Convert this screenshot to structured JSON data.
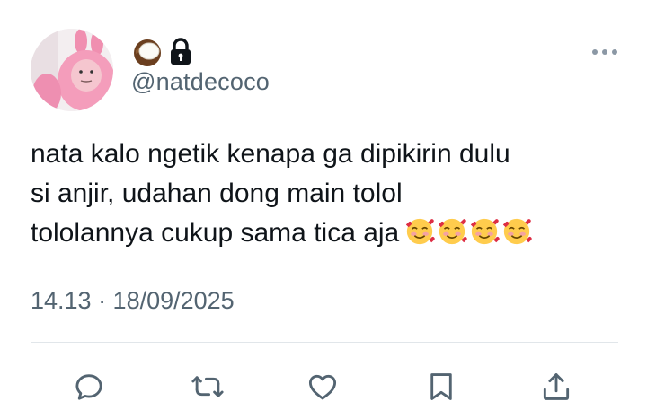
{
  "tweet": {
    "display_name_emoji": "coconut-emoji",
    "protected_icon": "lock-icon",
    "handle": "@natdecoco",
    "text_lines": [
      "nata kalo ngetik kenapa ga dipikirin dulu",
      "si anjir, udahan dong main tolol",
      "tololannya cukup sama tica aja"
    ],
    "text_trailing_emoji": [
      "smiling-face-with-hearts",
      "smiling-face-with-hearts",
      "smiling-face-with-hearts",
      "smiling-face-with-hearts"
    ],
    "timestamp": "14.13 · 18/09/2025"
  },
  "actions": [
    {
      "name": "reply",
      "icon": "reply-icon"
    },
    {
      "name": "retweet",
      "icon": "retweet-icon"
    },
    {
      "name": "like",
      "icon": "heart-icon"
    },
    {
      "name": "bookmark",
      "icon": "bookmark-icon"
    },
    {
      "name": "share",
      "icon": "share-icon"
    }
  ],
  "colors": {
    "text": "#0f1419",
    "secondary": "#536471",
    "divider": "#e1e6ea",
    "icon": "#536471"
  }
}
